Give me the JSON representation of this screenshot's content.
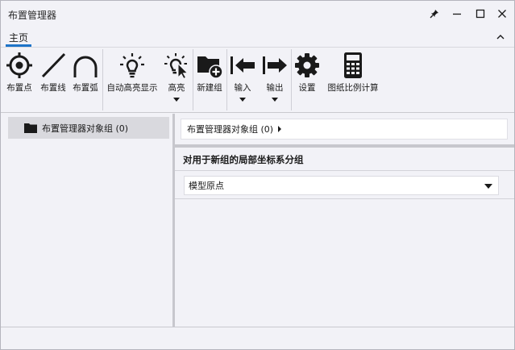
{
  "window": {
    "title": "布置管理器",
    "controls": [
      "pin-icon",
      "minimize-icon",
      "maximize-icon",
      "close-icon"
    ]
  },
  "ribbon": {
    "tab": "主页",
    "buttons": [
      {
        "id": "place-point",
        "label": "布置点",
        "icon": "crosshair-icon"
      },
      {
        "id": "place-line",
        "label": "布置线",
        "icon": "line-icon"
      },
      {
        "id": "place-arc",
        "label": "布置弧",
        "icon": "arc-icon"
      },
      {
        "id": "auto-highlight",
        "label": "自动高亮显示",
        "icon": "lightbulb-icon"
      },
      {
        "id": "highlight",
        "label": "高亮",
        "icon": "lightbulb-cursor-icon",
        "dropdown": true
      },
      {
        "id": "new-group",
        "label": "新建组",
        "icon": "folder-add-icon"
      },
      {
        "id": "import",
        "label": "输入",
        "icon": "import-arrow-icon",
        "dropdown": true
      },
      {
        "id": "export",
        "label": "输出",
        "icon": "export-arrow-icon",
        "dropdown": true
      },
      {
        "id": "settings",
        "label": "设置",
        "icon": "gear-icon"
      },
      {
        "id": "scale-calc",
        "label": "图纸比例计算",
        "icon": "calculator-icon"
      }
    ]
  },
  "tree": {
    "items": [
      {
        "label": "布置管理器对象组 (0)",
        "icon": "folder-icon",
        "selected": true
      }
    ]
  },
  "details": {
    "breadcrumb": "布置管理器对象组 (0)",
    "section_title": "对用于新组的局部坐标系分组",
    "coordinate_select": {
      "value": "模型原点"
    }
  },
  "colors": {
    "accent": "#1e74c8",
    "background": "#f2f2f7",
    "selected_item": "#d9d9de"
  }
}
